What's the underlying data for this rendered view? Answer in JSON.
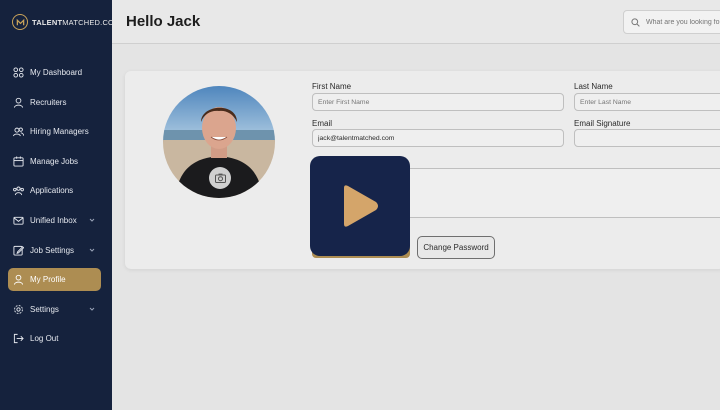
{
  "brand": {
    "logo_bold": "TALENT",
    "logo_rest": "MATCHED.COM",
    "accent": "#ad8d52",
    "sidebar_bg": "#15223d"
  },
  "header": {
    "title": "Hello Jack",
    "search_placeholder": "What are you looking for?"
  },
  "sidebar": {
    "items": [
      {
        "label": "My Dashboard",
        "icon": "grid-icon"
      },
      {
        "label": "Recruiters",
        "icon": "user-icon"
      },
      {
        "label": "Hiring Managers",
        "icon": "users-icon"
      },
      {
        "label": "Manage Jobs",
        "icon": "calendar-icon"
      },
      {
        "label": "Applications",
        "icon": "group-icon"
      },
      {
        "label": "Unified Inbox",
        "icon": "mail-icon",
        "has_chevron": true
      },
      {
        "label": "Job Settings",
        "icon": "edit-icon",
        "has_chevron": true
      },
      {
        "label": "My Profile",
        "icon": "profile-icon",
        "active": true
      },
      {
        "label": "Settings",
        "icon": "gear-icon",
        "has_chevron": true
      },
      {
        "label": "Log Out",
        "icon": "logout-icon"
      }
    ]
  },
  "profile": {
    "first_name_label": "First Name",
    "first_name_placeholder": "Enter First Name",
    "last_name_label": "Last Name",
    "last_name_placeholder": "Enter Last Name",
    "email_label": "Email",
    "email_value": "jack@talentmatched.com",
    "signature_label": "Email Signature",
    "change_password_label": "Change Password"
  },
  "video": {
    "icon": "play-icon"
  }
}
